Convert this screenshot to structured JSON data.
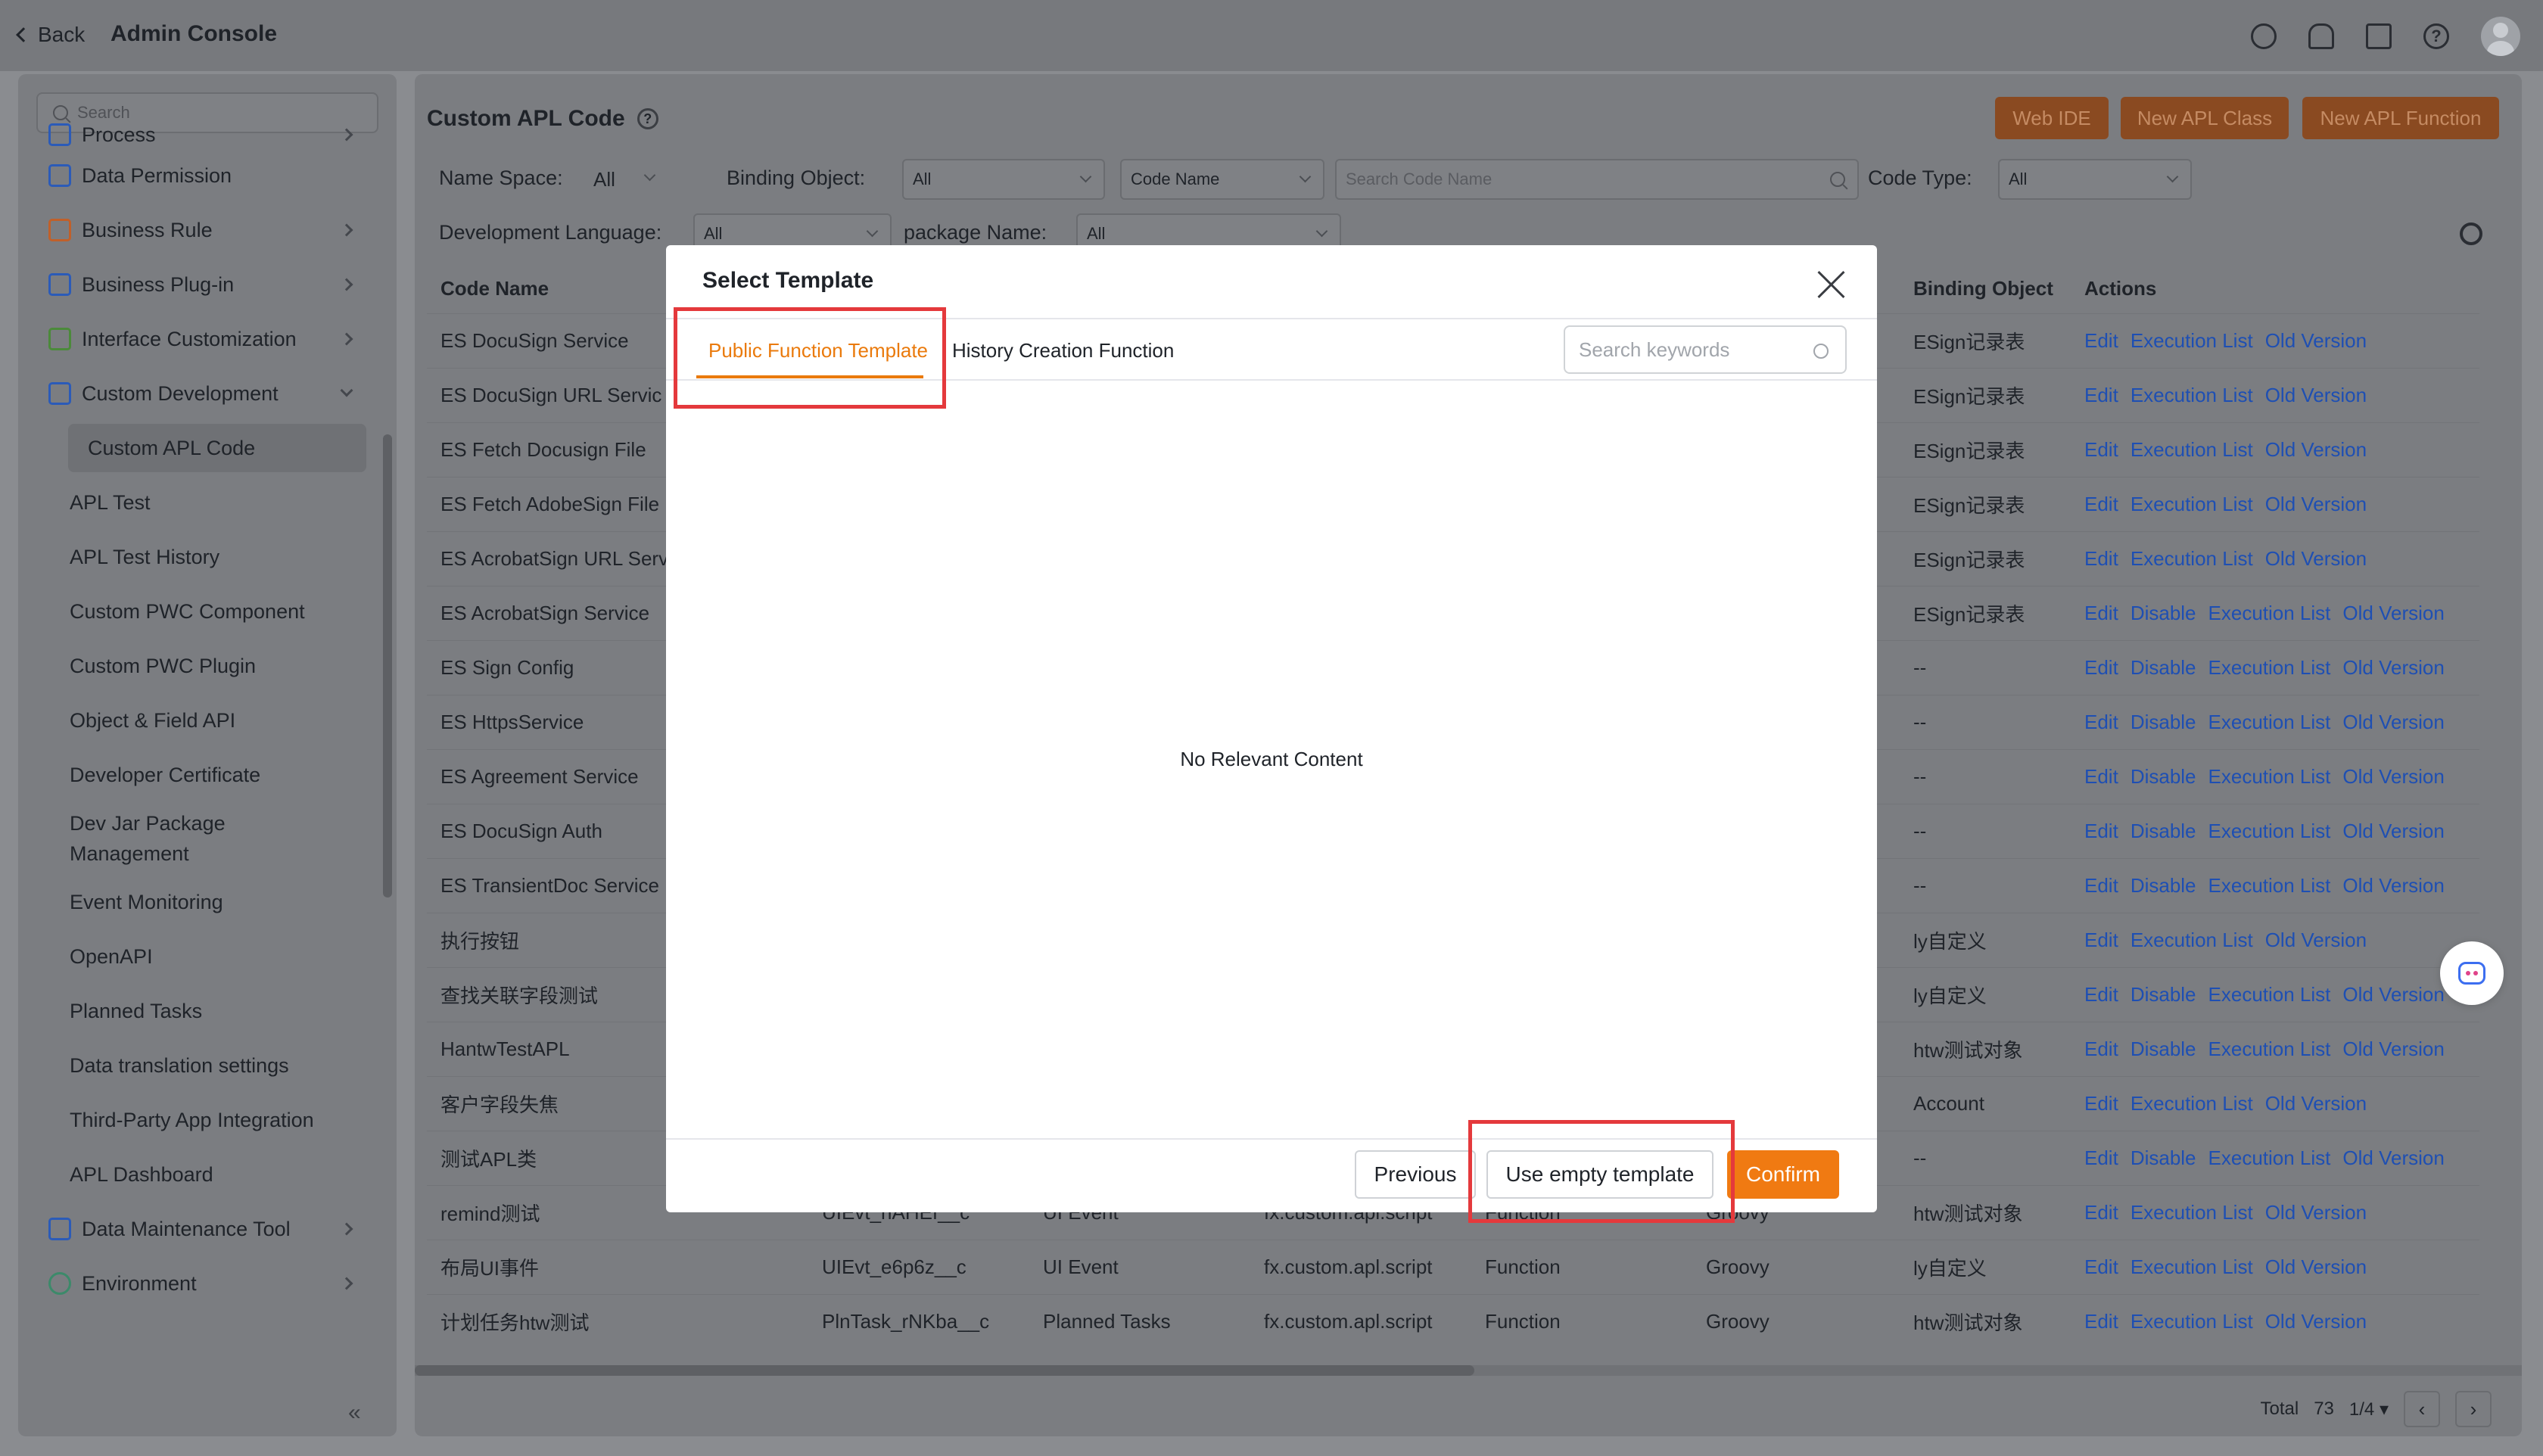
{
  "topbar": {
    "back_label": "Back",
    "app_title": "Admin Console"
  },
  "sidebar": {
    "search_placeholder": "Search",
    "items": [
      {
        "label": "Process"
      },
      {
        "label": "Data Permission"
      },
      {
        "label": "Business Rule"
      },
      {
        "label": "Business Plug-in"
      },
      {
        "label": "Interface Customization"
      },
      {
        "label": "Custom Development"
      },
      {
        "label": "Custom APL Code"
      },
      {
        "label": "APL Test"
      },
      {
        "label": "APL Test History"
      },
      {
        "label": "Custom PWC Component"
      },
      {
        "label": "Custom PWC Plugin"
      },
      {
        "label": "Object & Field API"
      },
      {
        "label": "Developer Certificate"
      },
      {
        "label": "Dev Jar Package Management"
      },
      {
        "label": "Event Monitoring"
      },
      {
        "label": "OpenAPI"
      },
      {
        "label": "Planned Tasks"
      },
      {
        "label": "Data translation settings"
      },
      {
        "label": "Third-Party App Integration"
      },
      {
        "label": "APL Dashboard"
      },
      {
        "label": "Data Maintenance Tool"
      },
      {
        "label": "Environment"
      }
    ],
    "collapse_icon": "«"
  },
  "main": {
    "title": "Custom APL Code",
    "buttons": {
      "web_ide": "Web IDE",
      "new_class": "New APL Class",
      "new_function": "New APL Function"
    },
    "filters": {
      "namespace_label": "Name Space:",
      "namespace_value": "All",
      "binding_label": "Binding Object:",
      "binding_value": "All",
      "code_name_select": "Code Name",
      "search_placeholder": "Search Code Name",
      "code_type_label": "Code Type:",
      "code_type_value": "All",
      "dev_lang_label": "Development Language:",
      "dev_lang_value": "All",
      "package_label": "package Name:",
      "package_value": "All"
    },
    "columns": {
      "code_name": "Code Name",
      "binding_object": "Binding Object",
      "actions": "Actions",
      "truncated": "..."
    },
    "rows": [
      {
        "name": "ES DocuSign Service",
        "c2": "",
        "c3": "",
        "c4": "",
        "c5": "",
        "c6": "",
        "binding": "ESign记录表",
        "actions": [
          "Edit",
          "Execution List",
          "Old Version"
        ]
      },
      {
        "name": "ES DocuSign URL Servic",
        "c2": "",
        "c3": "",
        "c4": "",
        "c5": "",
        "c6": "",
        "binding": "ESign记录表",
        "actions": [
          "Edit",
          "Execution List",
          "Old Version"
        ]
      },
      {
        "name": "ES Fetch Docusign File",
        "c2": "",
        "c3": "",
        "c4": "",
        "c5": "",
        "c6": "",
        "binding": "ESign记录表",
        "actions": [
          "Edit",
          "Execution List",
          "Old Version"
        ]
      },
      {
        "name": "ES Fetch AdobeSign File",
        "c2": "",
        "c3": "",
        "c4": "",
        "c5": "",
        "c6": "",
        "binding": "ESign记录表",
        "actions": [
          "Edit",
          "Execution List",
          "Old Version"
        ]
      },
      {
        "name": "ES AcrobatSign URL Serv",
        "c2": "",
        "c3": "",
        "c4": "",
        "c5": "",
        "c6": "",
        "binding": "ESign记录表",
        "actions": [
          "Edit",
          "Execution List",
          "Old Version"
        ]
      },
      {
        "name": "ES AcrobatSign Service",
        "c2": "",
        "c3": "",
        "c4": "",
        "c5": "",
        "c6": "",
        "binding": "ESign记录表",
        "actions": [
          "Edit",
          "Disable",
          "Execution List",
          "Old Version"
        ]
      },
      {
        "name": "ES Sign Config",
        "c2": "",
        "c3": "",
        "c4": "",
        "c5": "",
        "c6": "",
        "binding": "--",
        "actions": [
          "Edit",
          "Disable",
          "Execution List",
          "Old Version"
        ]
      },
      {
        "name": "ES HttpsService",
        "c2": "",
        "c3": "",
        "c4": "",
        "c5": "",
        "c6": "",
        "binding": "--",
        "actions": [
          "Edit",
          "Disable",
          "Execution List",
          "Old Version"
        ]
      },
      {
        "name": "ES Agreement Service",
        "c2": "",
        "c3": "",
        "c4": "",
        "c5": "",
        "c6": "",
        "binding": "--",
        "actions": [
          "Edit",
          "Disable",
          "Execution List",
          "Old Version"
        ]
      },
      {
        "name": "ES DocuSign Auth",
        "c2": "",
        "c3": "",
        "c4": "",
        "c5": "",
        "c6": "",
        "binding": "--",
        "actions": [
          "Edit",
          "Disable",
          "Execution List",
          "Old Version"
        ]
      },
      {
        "name": "ES TransientDoc Service",
        "c2": "",
        "c3": "",
        "c4": "",
        "c5": "",
        "c6": "",
        "binding": "--",
        "actions": [
          "Edit",
          "Disable",
          "Execution List",
          "Old Version"
        ]
      },
      {
        "name": "执行按钮",
        "c2": "",
        "c3": "",
        "c4": "",
        "c5": "",
        "c6": "",
        "binding": "ly自定义",
        "actions": [
          "Edit",
          "Execution List",
          "Old Version"
        ]
      },
      {
        "name": "查找关联字段测试",
        "c2": "",
        "c3": "",
        "c4": "",
        "c5": "",
        "c6": "",
        "binding": "ly自定义",
        "actions": [
          "Edit",
          "Disable",
          "Execution List",
          "Old Version"
        ]
      },
      {
        "name": "HantwTestAPL",
        "c2": "",
        "c3": "",
        "c4": "",
        "c5": "",
        "c6": "",
        "binding": "htw测试对象",
        "actions": [
          "Edit",
          "Disable",
          "Execution List",
          "Old Version"
        ]
      },
      {
        "name": "客户字段失焦",
        "c2": "",
        "c3": "",
        "c4": "",
        "c5": "",
        "c6": "",
        "binding": "Account",
        "actions": [
          "Edit",
          "Execution List",
          "Old Version"
        ]
      },
      {
        "name": "测试APL类",
        "c2": "",
        "c3": "",
        "c4": "",
        "c5": "",
        "c6": "",
        "binding": "--",
        "actions": [
          "Edit",
          "Disable",
          "Execution List",
          "Old Version"
        ]
      },
      {
        "name": "remind测试",
        "c2": "UIEvt_hAHEf__c",
        "c3": "UI Event",
        "c4": "fx.custom.apl.script",
        "c5": "Function",
        "c6": "Groovy",
        "binding": "htw测试对象",
        "actions": [
          "Edit",
          "Execution List",
          "Old Version"
        ]
      },
      {
        "name": "布局UI事件",
        "c2": "UIEvt_e6p6z__c",
        "c3": "UI Event",
        "c4": "fx.custom.apl.script",
        "c5": "Function",
        "c6": "Groovy",
        "binding": "ly自定义",
        "actions": [
          "Edit",
          "Execution List",
          "Old Version"
        ]
      },
      {
        "name": "计划任务htw测试",
        "c2": "PlnTask_rNKba__c",
        "c3": "Planned Tasks",
        "c4": "fx.custom.apl.script",
        "c5": "Function",
        "c6": "Groovy",
        "binding": "htw测试对象",
        "actions": [
          "Edit",
          "Execution List",
          "Old Version"
        ]
      }
    ],
    "pager": {
      "total_label": "Total",
      "total": "73",
      "page": "1/4",
      "prev": "‹",
      "next": "›"
    }
  },
  "modal": {
    "title": "Select Template",
    "tabs": [
      "Public Function Template",
      "History Creation Function"
    ],
    "active_tab": 0,
    "search_placeholder": "Search keywords",
    "empty_text": "No Relevant Content",
    "buttons": {
      "previous": "Previous",
      "use_empty": "Use empty template",
      "confirm": "Confirm"
    }
  },
  "colors": {
    "accent": "#f07a12",
    "link": "#1e4fb3",
    "highlight": "#e4393c"
  }
}
